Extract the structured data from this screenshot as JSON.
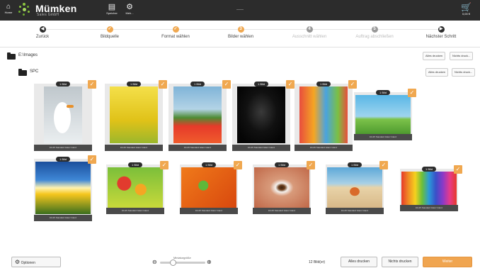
{
  "topbar": {
    "home_label": "Home",
    "brand": "Mümken",
    "brand_sub": "Sales GmbH",
    "tools": [
      {
        "label": "Speicher",
        "icon": "save-icon"
      },
      {
        "label": "Meh...",
        "icon": "settings-icon"
      }
    ],
    "cart_label": "0,00 €"
  },
  "steps": [
    {
      "label": "Zurück",
      "icon": "back-arrow-icon",
      "state": "nav",
      "glyph": "◀"
    },
    {
      "label": "Bildquelle",
      "state": "done",
      "glyph": "✓"
    },
    {
      "label": "Format wählen",
      "state": "done",
      "glyph": "✓"
    },
    {
      "label": "Bilder wählen",
      "state": "current",
      "glyph": "3"
    },
    {
      "label": "Ausschnitt wählen",
      "state": "todo",
      "glyph": "4"
    },
    {
      "label": "Auftrag abschließen",
      "state": "todo",
      "glyph": "5"
    },
    {
      "label": "Nächster Schritt",
      "icon": "next-arrow-icon",
      "state": "nav",
      "glyph": "▶"
    }
  ],
  "folders": [
    {
      "name": "E:\\Images",
      "print_all": "Alles drucken",
      "print_none": "Nichts druck..."
    },
    {
      "name": "SPC",
      "print_all": "Alles drucken",
      "print_none": "Nichts druck..."
    }
  ],
  "badge": "1 Bild",
  "tile_caption": "10x15 Standard Glanz Glanz",
  "tiles": [
    {
      "name": "goose"
    },
    {
      "name": "rapeseed"
    },
    {
      "name": "windmill-tulips"
    },
    {
      "name": "black-dog"
    },
    {
      "name": "colorful-houses"
    },
    {
      "name": "girl-balloons"
    },
    {
      "name": "sunflowers"
    },
    {
      "name": "fruits"
    },
    {
      "name": "frog"
    },
    {
      "name": "eye"
    },
    {
      "name": "crab"
    },
    {
      "name": "pencils"
    }
  ],
  "footer": {
    "options": "Optionen",
    "thumb_size": "Miniaturgröße",
    "count": "12 Bild(er)",
    "print_all": "Alles drucken",
    "print_none": "Nichts drucken",
    "next": "Weiter"
  }
}
